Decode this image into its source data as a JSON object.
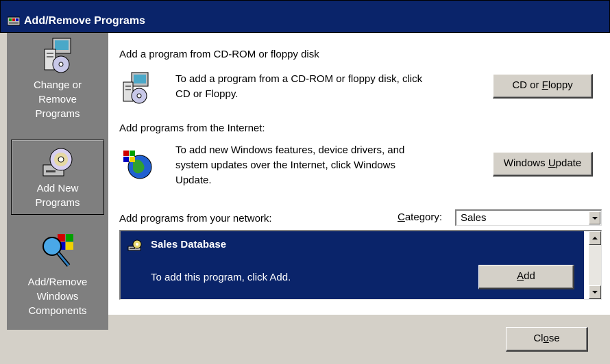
{
  "window": {
    "title": "Add/Remove Programs"
  },
  "sidebar": {
    "items": [
      {
        "label": "Change or Remove Programs",
        "lines": [
          "Change or",
          "Remove",
          "Programs"
        ]
      },
      {
        "label": "Add New Programs",
        "lines": [
          "Add New",
          "Programs"
        ],
        "selected": true
      },
      {
        "label": "Add/Remove Windows Components",
        "lines": [
          "Add/Remove",
          "Windows",
          "Components"
        ]
      }
    ]
  },
  "cdrom": {
    "heading": "Add a program from CD-ROM or floppy disk",
    "desc_line1": "To add a program from a CD-ROM or floppy disk, click",
    "desc_line2": "CD or Floppy.",
    "button_prefix": "CD or ",
    "button_accel": "F",
    "button_suffix": "loppy"
  },
  "internet": {
    "heading": "Add programs from the Internet:",
    "desc_line1": "To add new Windows features, device drivers, and",
    "desc_line2": "system updates over the Internet, click Windows",
    "desc_line3": "Update.",
    "button_prefix": "Windows ",
    "button_accel": "U",
    "button_suffix": "pdate"
  },
  "network": {
    "heading": "Add programs from your network:",
    "category_accel": "C",
    "category_label_rest": "ategory:",
    "category_value": "Sales",
    "program_name": "Sales Database",
    "program_desc": "To add this program, click Add.",
    "add_accel": "A",
    "add_rest": "dd"
  },
  "footer": {
    "close_prefix": "Cl",
    "close_accel": "o",
    "close_suffix": "se"
  },
  "colors": {
    "titlebar": "#0a246a",
    "selection": "#0a246a",
    "sidebar": "#7f7f7f",
    "button_face": "#d4d0c8"
  }
}
